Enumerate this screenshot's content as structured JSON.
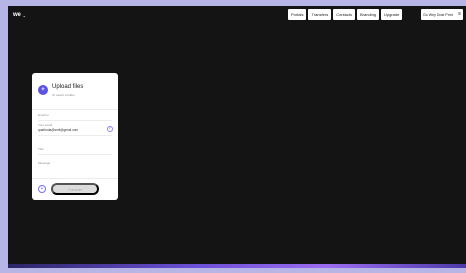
{
  "header": {
    "logo_text": "we",
    "logo_chevron": "⌄",
    "nav": [
      "Portals",
      "Transfers",
      "Contacts",
      "Branding",
      "Upgrade"
    ],
    "account": {
      "label": "Go Wey Dost Print",
      "menu_icon": "≡"
    }
  },
  "upload_card": {
    "icon_glyph": "+",
    "title": "Upload files",
    "subtitle": "Or select a folder",
    "fields": {
      "email_to": {
        "label": "Email to"
      },
      "your_email": {
        "label": "Your email",
        "value": "quathuda@smit@gmail.com"
      },
      "title": {
        "label": "Title"
      },
      "message": {
        "label": "Message"
      }
    },
    "check_glyph": "✓",
    "add_glyph": "+",
    "transfer_label": "Transfer"
  },
  "colors": {
    "accent": "#5b52e0",
    "app_background": "#141414",
    "frame_background": "#b7b4e6"
  }
}
